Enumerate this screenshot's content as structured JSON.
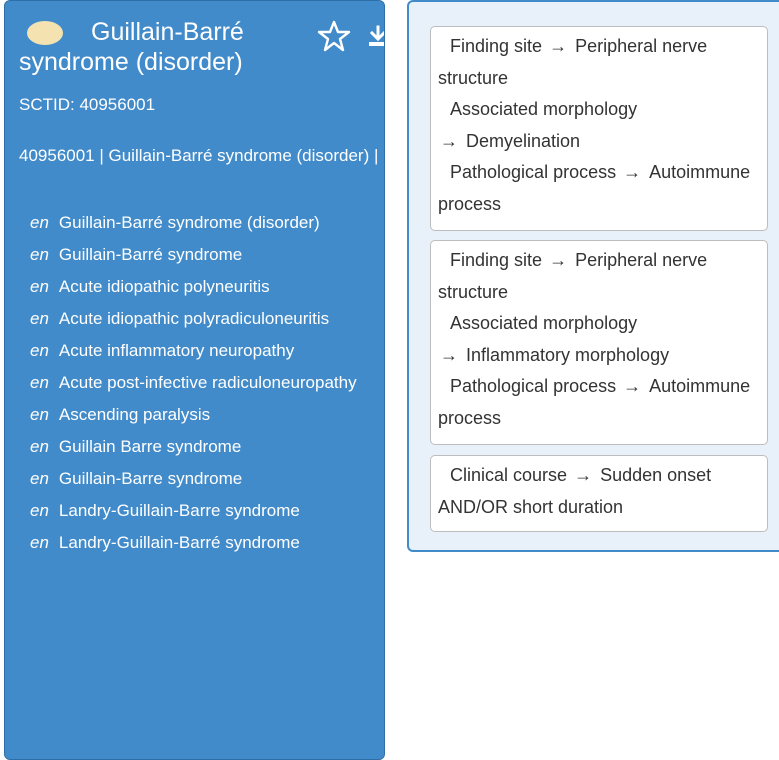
{
  "concept": {
    "title": "Guillain-Barré syndrome (disorder)",
    "badge_color": "#f4e3b0",
    "sctid_label": "SCTID: 40956001",
    "fsn_line": "40956001 | Guillain-Barré syndrome (disorder) |",
    "star_icon": "star-outline-icon",
    "download_icon": "download-icon",
    "descriptions": [
      {
        "lang": "en",
        "term": "Guillain-Barré syndrome (disorder)"
      },
      {
        "lang": "en",
        "term": "Guillain-Barré syndrome"
      },
      {
        "lang": "en",
        "term": "Acute idiopathic polyneuritis"
      },
      {
        "lang": "en",
        "term": "Acute idiopathic polyradiculoneuritis"
      },
      {
        "lang": "en",
        "term": "Acute inflammatory neuropathy"
      },
      {
        "lang": "en",
        "term": "Acute post-infective radiculoneuropathy"
      },
      {
        "lang": "en",
        "term": "Ascending paralysis"
      },
      {
        "lang": "en",
        "term": "Guillain Barre syndrome"
      },
      {
        "lang": "en",
        "term": "Guillain-Barre syndrome"
      },
      {
        "lang": "en",
        "term": "Landry-Guillain-Barre syndrome"
      },
      {
        "lang": "en",
        "term": "Landry-Guillain-Barré syndrome"
      }
    ]
  },
  "relationships": {
    "arrow": "→",
    "groups": [
      [
        {
          "type": "Finding site",
          "target": "Peripheral nerve structure"
        },
        {
          "type": "Associated morphology",
          "target": "Demyelination"
        },
        {
          "type": "Pathological process",
          "target": "Autoimmune process"
        }
      ],
      [
        {
          "type": "Finding site",
          "target": "Peripheral nerve structure"
        },
        {
          "type": "Associated morphology",
          "target": "Inflammatory morphology"
        },
        {
          "type": "Pathological process",
          "target": "Autoimmune process"
        }
      ],
      [
        {
          "type": "Clinical course",
          "target": "Sudden onset AND/OR short duration"
        }
      ]
    ]
  },
  "colors": {
    "panel_blue": "#428bca",
    "relationships_bg": "#e8f1fa"
  }
}
